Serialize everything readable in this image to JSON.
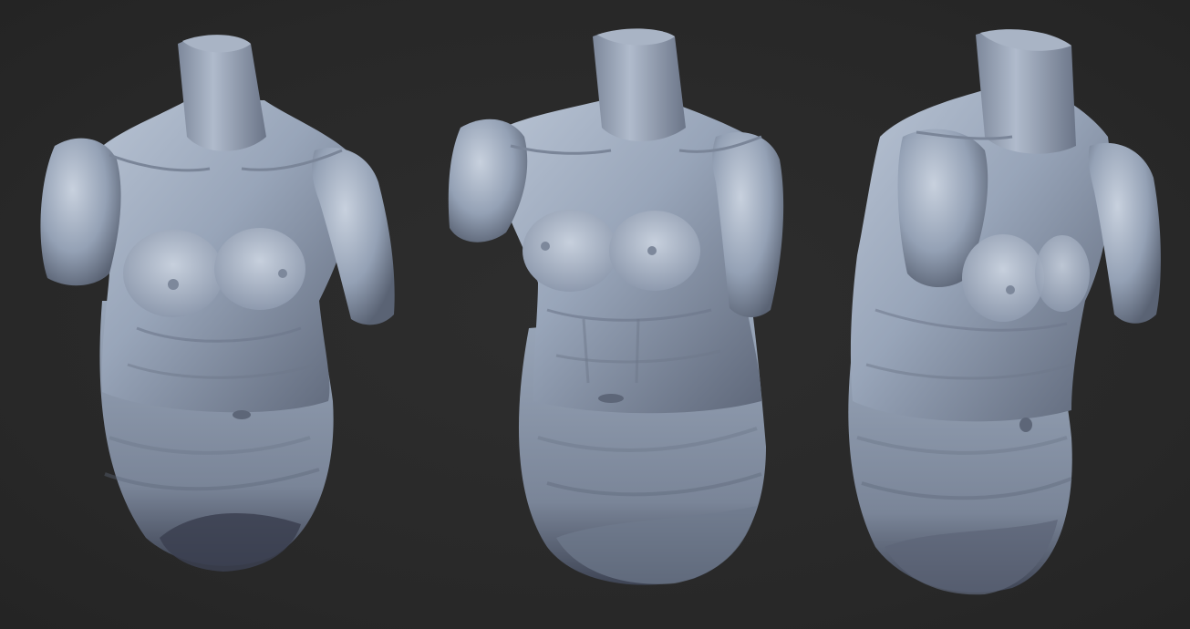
{
  "scene": {
    "background_color": "#2a2a2a",
    "material_base_color": "#8e9bb0",
    "material_highlight_color": "#c4cedd",
    "material_shadow_color": "#3a4050",
    "views": [
      {
        "id": "front",
        "label": ""
      },
      {
        "id": "three-quarter",
        "label": ""
      },
      {
        "id": "side",
        "label": ""
      }
    ]
  }
}
